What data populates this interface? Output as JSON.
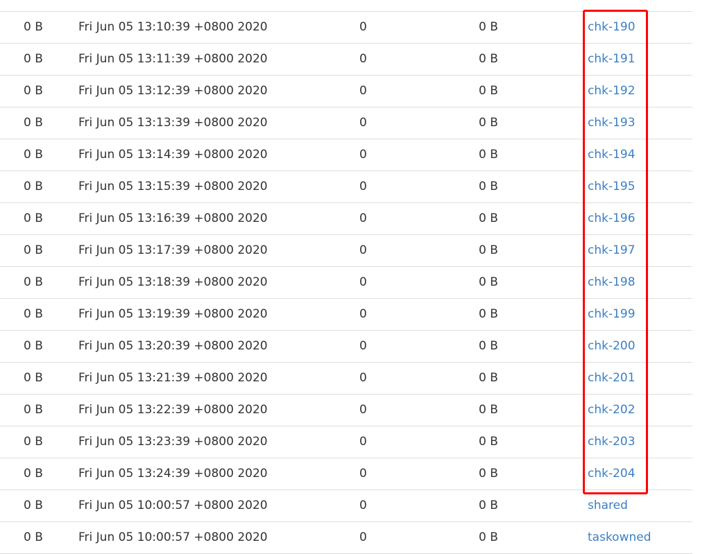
{
  "table": {
    "rows": [
      {
        "size": "0 B",
        "modified": "Fri Jun 05 13:10:39 +0800 2020",
        "count": "0",
        "size2": "0 B",
        "name": "chk-190"
      },
      {
        "size": "0 B",
        "modified": "Fri Jun 05 13:11:39 +0800 2020",
        "count": "0",
        "size2": "0 B",
        "name": "chk-191"
      },
      {
        "size": "0 B",
        "modified": "Fri Jun 05 13:12:39 +0800 2020",
        "count": "0",
        "size2": "0 B",
        "name": "chk-192"
      },
      {
        "size": "0 B",
        "modified": "Fri Jun 05 13:13:39 +0800 2020",
        "count": "0",
        "size2": "0 B",
        "name": "chk-193"
      },
      {
        "size": "0 B",
        "modified": "Fri Jun 05 13:14:39 +0800 2020",
        "count": "0",
        "size2": "0 B",
        "name": "chk-194"
      },
      {
        "size": "0 B",
        "modified": "Fri Jun 05 13:15:39 +0800 2020",
        "count": "0",
        "size2": "0 B",
        "name": "chk-195"
      },
      {
        "size": "0 B",
        "modified": "Fri Jun 05 13:16:39 +0800 2020",
        "count": "0",
        "size2": "0 B",
        "name": "chk-196"
      },
      {
        "size": "0 B",
        "modified": "Fri Jun 05 13:17:39 +0800 2020",
        "count": "0",
        "size2": "0 B",
        "name": "chk-197"
      },
      {
        "size": "0 B",
        "modified": "Fri Jun 05 13:18:39 +0800 2020",
        "count": "0",
        "size2": "0 B",
        "name": "chk-198"
      },
      {
        "size": "0 B",
        "modified": "Fri Jun 05 13:19:39 +0800 2020",
        "count": "0",
        "size2": "0 B",
        "name": "chk-199"
      },
      {
        "size": "0 B",
        "modified": "Fri Jun 05 13:20:39 +0800 2020",
        "count": "0",
        "size2": "0 B",
        "name": "chk-200"
      },
      {
        "size": "0 B",
        "modified": "Fri Jun 05 13:21:39 +0800 2020",
        "count": "0",
        "size2": "0 B",
        "name": "chk-201"
      },
      {
        "size": "0 B",
        "modified": "Fri Jun 05 13:22:39 +0800 2020",
        "count": "0",
        "size2": "0 B",
        "name": "chk-202"
      },
      {
        "size": "0 B",
        "modified": "Fri Jun 05 13:23:39 +0800 2020",
        "count": "0",
        "size2": "0 B",
        "name": "chk-203"
      },
      {
        "size": "0 B",
        "modified": "Fri Jun 05 13:24:39 +0800 2020",
        "count": "0",
        "size2": "0 B",
        "name": "chk-204"
      },
      {
        "size": "0 B",
        "modified": "Fri Jun 05 10:00:57 +0800 2020",
        "count": "0",
        "size2": "0 B",
        "name": "shared"
      },
      {
        "size": "0 B",
        "modified": "Fri Jun 05 10:00:57 +0800 2020",
        "count": "0",
        "size2": "0 B",
        "name": "taskowned"
      }
    ]
  },
  "colors": {
    "link": "#3b7fc4",
    "highlight": "#ff0000",
    "row_border": "#dddddd"
  }
}
